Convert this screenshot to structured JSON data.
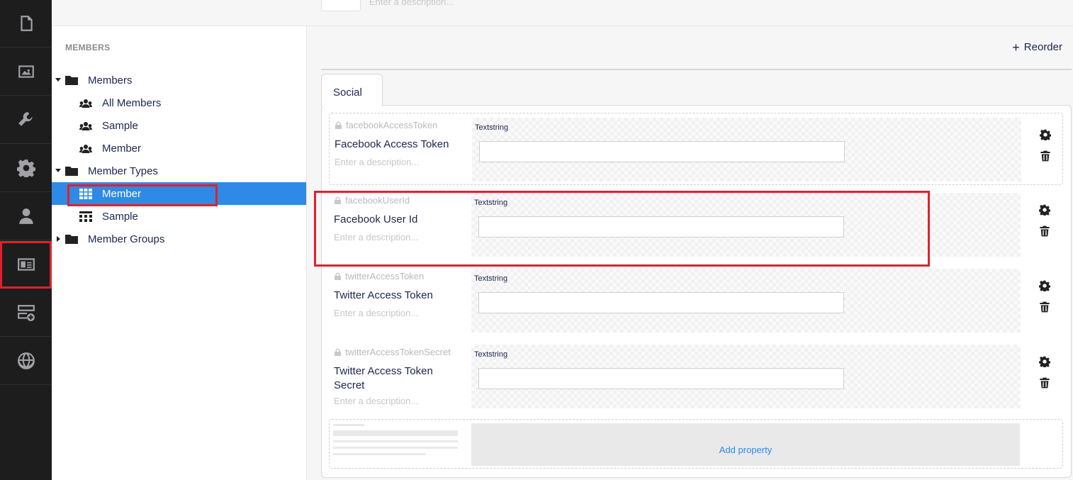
{
  "sections": [
    {
      "icon": "document-icon"
    },
    {
      "icon": "media-icon"
    },
    {
      "icon": "wrench-icon"
    },
    {
      "icon": "gear-icon"
    },
    {
      "icon": "user-icon"
    },
    {
      "icon": "member-card-icon"
    },
    {
      "icon": "form-add-icon"
    },
    {
      "icon": "globe-icon"
    }
  ],
  "tree": {
    "title": "MEMBERS",
    "nodes": [
      {
        "label": "Members",
        "icon": "folder-icon",
        "caret": "down"
      },
      {
        "label": "All Members",
        "icon": "users-icon"
      },
      {
        "label": "Sample",
        "icon": "users-icon"
      },
      {
        "label": "Member",
        "icon": "users-icon"
      },
      {
        "label": "Member Types",
        "icon": "folder-icon",
        "caret": "down"
      },
      {
        "label": "Member",
        "icon": "grid-icon",
        "active": true
      },
      {
        "label": "Sample",
        "icon": "grid-icon"
      },
      {
        "label": "Member Groups",
        "icon": "folder-icon",
        "caret": "right"
      }
    ]
  },
  "header": {
    "description_placeholder": "Enter a description..."
  },
  "toolbar": {
    "reorder_label": "Reorder"
  },
  "group": {
    "tab_label": "Social",
    "properties": [
      {
        "alias": "facebookAccessToken",
        "name": "Facebook Access Token",
        "description": "Enter a description...",
        "type": "Textstring"
      },
      {
        "alias": "facebookUserId",
        "name": "Facebook User Id",
        "description": "Enter a description...",
        "type": "Textstring"
      },
      {
        "alias": "twitterAccessToken",
        "name": "Twitter Access Token",
        "description": "Enter a description...",
        "type": "Textstring"
      },
      {
        "alias": "twitterAccessTokenSecret",
        "name": "Twitter Access Token Secret",
        "description": "Enter a description...",
        "type": "Textstring"
      }
    ],
    "add_property_label": "Add property"
  },
  "colors": {
    "active": "#2e8ae6",
    "highlight": "#e3202a",
    "section_bar": "#1d1d1d"
  }
}
